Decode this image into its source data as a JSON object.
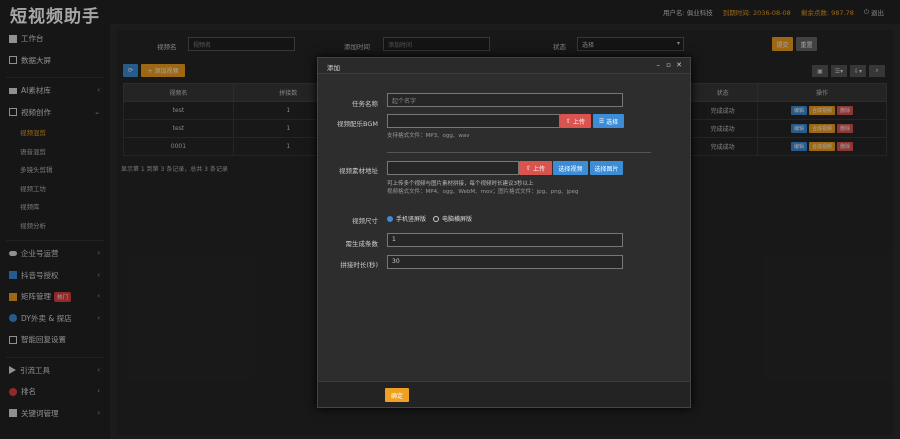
{
  "app": {
    "logo": "短视频助手",
    "user_label": "用户名:",
    "user_value": "俱业科技",
    "expire_label": "到期时间:",
    "expire_value": "2036-08-08",
    "points_label": "剩余点数:",
    "points_value": "987.78",
    "logout": "退出"
  },
  "sidebar": {
    "items": [
      {
        "label": "工作台",
        "icon": "home-icon"
      },
      {
        "label": "数据大屏",
        "icon": "chart-icon"
      },
      {
        "label": "AI素材库",
        "icon": "folder-icon"
      },
      {
        "label": "视频创作",
        "icon": "video-icon"
      },
      {
        "label": "企业号运营",
        "icon": "cloud-icon"
      },
      {
        "label": "抖音号授权",
        "icon": "auth-icon"
      },
      {
        "label": "矩阵管理",
        "icon": "matrix-icon",
        "badge": "热门"
      },
      {
        "label": "DY外卖 & 探店",
        "icon": "store-icon"
      },
      {
        "label": "智能回复设置",
        "icon": "reply-icon"
      },
      {
        "label": "引流工具",
        "icon": "send-icon"
      },
      {
        "label": "排名",
        "icon": "rank-icon"
      },
      {
        "label": "关键词管理",
        "icon": "keyword-icon"
      }
    ],
    "sub_items": [
      "视频混剪",
      "语音混剪",
      "多镜头剪辑",
      "视频工坊",
      "视频库",
      "视频分析"
    ]
  },
  "filter": {
    "name_label": "视频名",
    "name_placeholder": "视频名",
    "time_label": "添加时间",
    "time_placeholder": "添加时间",
    "status_label": "状态",
    "status_value": "选择",
    "submit": "提交",
    "reset": "重置"
  },
  "toolbar": {
    "refresh": "⟳",
    "add": "+ 添加视频"
  },
  "table": {
    "headers": [
      "视频名",
      "拼接数"
    ],
    "headers_right": [
      "状态",
      "操作"
    ],
    "rows": [
      {
        "name": "test",
        "count": "1",
        "status": "完成成功"
      },
      {
        "name": "test",
        "count": "1",
        "status": "完成成功"
      },
      {
        "name": "0001",
        "count": "1",
        "status": "完成成功"
      }
    ],
    "ops": [
      "编辑",
      "合成视频",
      "删除"
    ],
    "pager": "显示第 1 到第 3 条记录，总共 3 条记录"
  },
  "modal": {
    "title": "添加",
    "task_label": "任务名称",
    "task_placeholder": "起个名字",
    "bgm_label": "视频配乐BGM",
    "bgm_upload": "上传",
    "bgm_select": "选择",
    "bgm_hint": "支持格式文件：MP3、ogg、wav",
    "material_label": "视频素材地址",
    "mat_upload": "上传",
    "mat_select_video": "选择视频",
    "mat_select_image": "选择图片",
    "mat_hint1": "可上传多个视频与图片素材拼接，每个视频时长建议3秒以上",
    "mat_hint2": "视频格式文件：MP4、ogg、WebM、mov；图片格式文件：jpg、png、jpeg",
    "size_label": "视频尺寸",
    "size_opt1": "手机竖屏版",
    "size_opt2": "电脑横屏版",
    "count_label": "需生成条数",
    "count_value": "1",
    "duration_label": "拼接时长(秒)",
    "duration_value": "30",
    "confirm": "确定"
  },
  "colors": {
    "accent": "#f0a020",
    "primary": "#3c8dd6",
    "danger": "#d9534f",
    "bg": "#2b2b2b"
  }
}
